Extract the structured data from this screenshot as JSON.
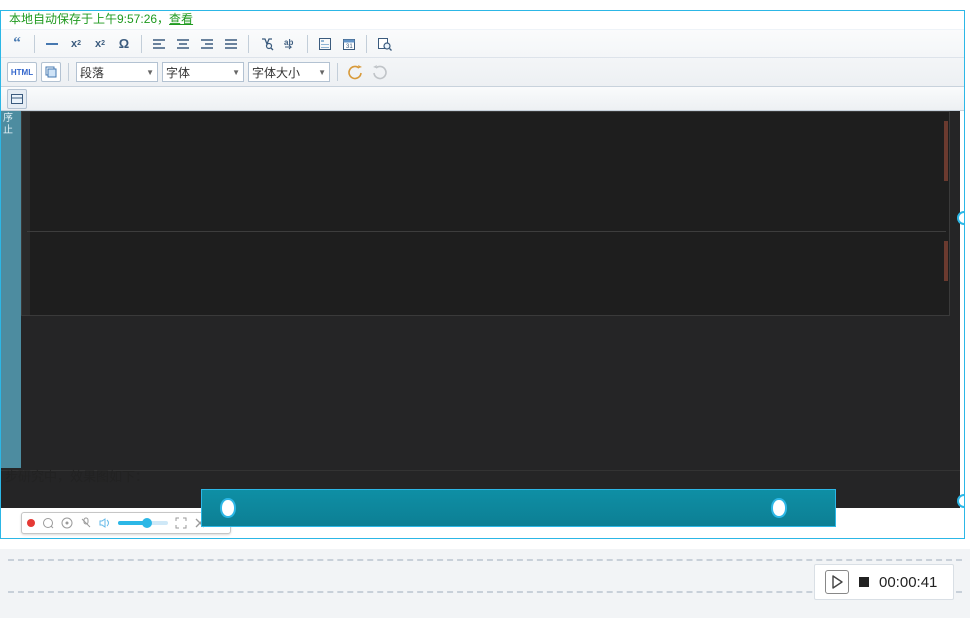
{
  "autosave": {
    "text": "本地自动保存于上午9:57:26，",
    "view": "查看"
  },
  "toolbar": {
    "row1": {
      "blockquote": "blockquote-icon",
      "hr": "hr-icon",
      "sub": "subscript-icon",
      "sup": "superscript-icon",
      "omega": "Ω",
      "align_left": "align-left-icon",
      "align_center": "align-center-icon",
      "align_right": "align-right-icon",
      "align_justify": "align-justify-icon",
      "find": "find-icon",
      "replace": "replace-icon",
      "fullscreen": "fullscreen-icon",
      "date": "date-icon",
      "preview": "preview-icon"
    },
    "row2": {
      "html_label": "HTML",
      "layers": "layers-icon",
      "format": "段落",
      "font": "字体",
      "font_size": "字体大小",
      "undo": "undo-icon",
      "redo": "redo-icon"
    },
    "row3": {
      "cell": "cell-icon"
    }
  },
  "canvas": {
    "sidepane_text": "序止",
    "content_text": "步研究中，效果图如下：",
    "record_bar": {
      "record": "record-icon",
      "magnify": "magnify-icon",
      "mic_off": "mic-off-icon",
      "volume": "volume-icon",
      "fullscreen": "fullscreen-icon",
      "close": "close-icon"
    },
    "sel2_left_handle": "handle",
    "sel2_right_handle": "handle"
  },
  "recorder": {
    "play": "play-icon",
    "stop": "stop-icon",
    "time": "00:00:41"
  }
}
